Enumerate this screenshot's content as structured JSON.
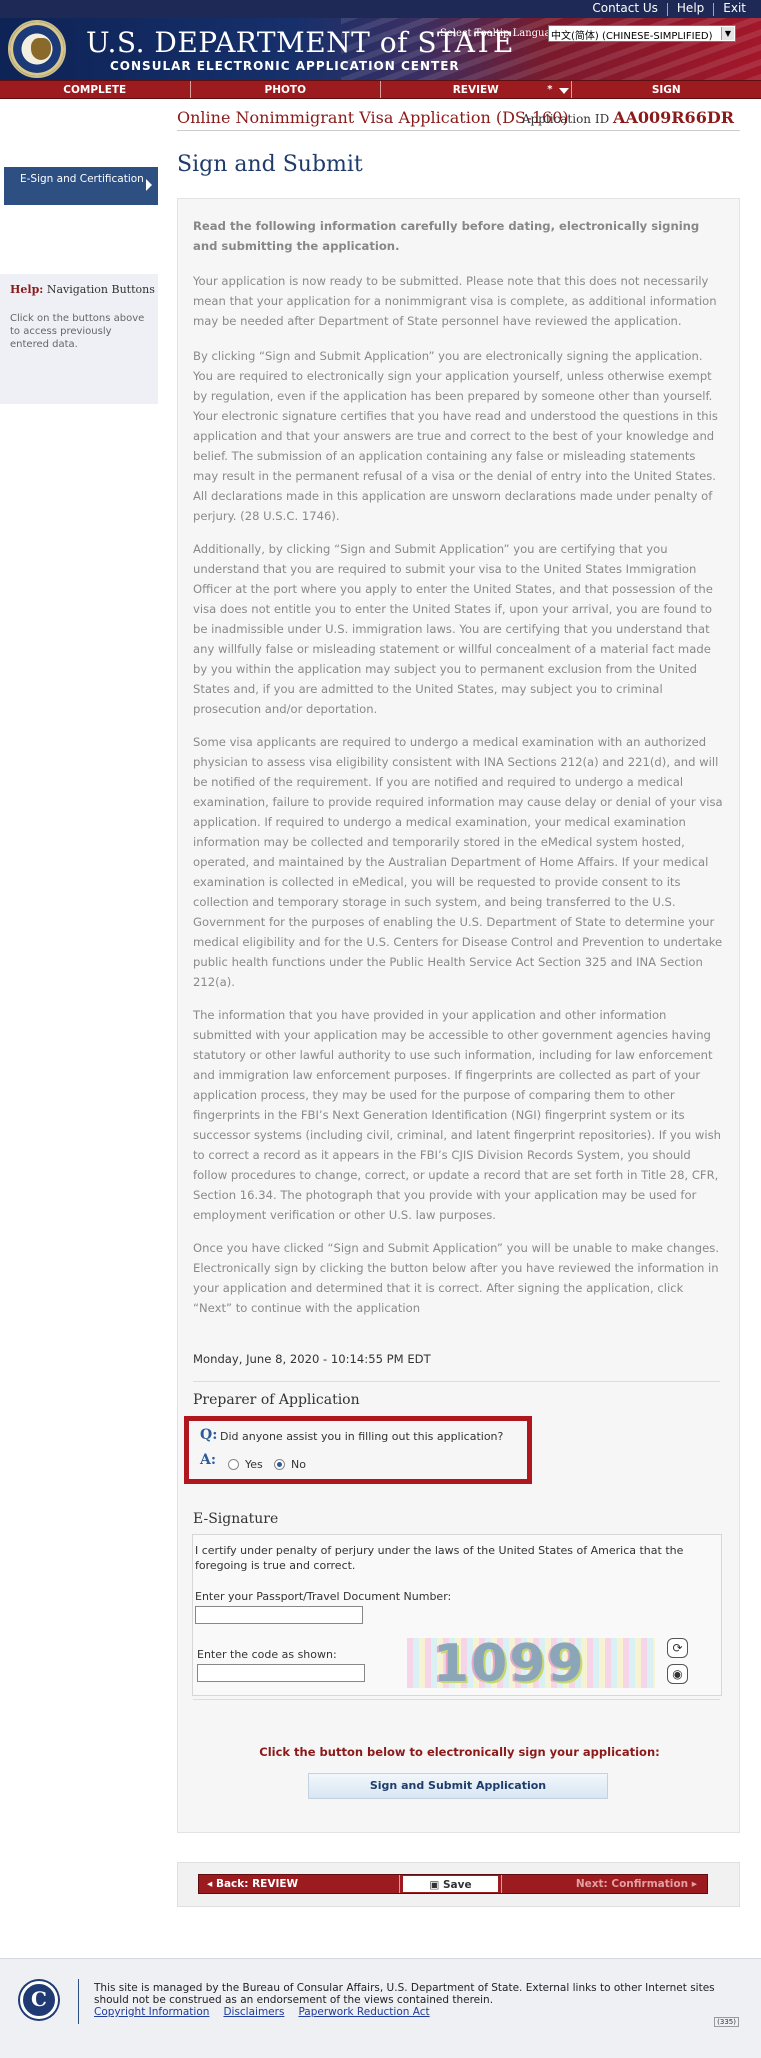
{
  "top_links": [
    "Contact Us",
    "Help",
    "Exit"
  ],
  "header": {
    "dept_name": "U.S. DEPARTMENT of STATE",
    "subtitle": "CONSULAR ELECTRONIC APPLICATION CENTER",
    "tooltip_label": "Select Tooltip Language",
    "language_selected": "中文(简体) (CHINESE-SIMPLIFIED)"
  },
  "steps": [
    "COMPLETE",
    "PHOTO",
    "REVIEW",
    "SIGN"
  ],
  "steps_review_marker": "*",
  "sidebar": {
    "active_item": "E-Sign and Certification",
    "help_title_prefix": "Help:",
    "help_title": "Navigation Buttons",
    "help_text": "Click on the buttons above to access previously entered data."
  },
  "app": {
    "form_title": "Online Nonimmigrant Visa Application (DS-160)",
    "app_id_label": "Application ID",
    "app_id": "AA009R66DR",
    "page_title": "Sign and Submit"
  },
  "content": {
    "lead": "Read the following information carefully before dating, electronically signing and submitting the application.",
    "p1": "Your application is now ready to be submitted. Please note that this does not necessarily mean that your application for a nonimmigrant visa is complete, as additional information may be needed after Department of State personnel have reviewed the application.",
    "p2": "By clicking “Sign and Submit Application” you are electronically signing the application. You are required to electronically sign your application yourself, unless otherwise exempt by regulation, even if the application has been prepared by someone other than yourself. Your electronic signature certifies that you have read and understood the questions in this application and that your answers are true and correct to the best of your knowledge and belief. The submission of an application containing any false or misleading statements may result in the permanent refusal of a visa or the denial of entry into the United States. All declarations made in this application are unsworn declarations made under penalty of perjury. (28 U.S.C. 1746).",
    "p3": "Additionally, by clicking “Sign and Submit Application” you are certifying that you understand that you are required to submit your visa to the United States Immigration Officer at the port where you apply to enter the United States, and that possession of the visa does not entitle you to enter the United States if, upon your arrival, you are found to be inadmissible under U.S. immigration laws. You are certifying that you understand that any willfully false or misleading statement or willful concealment of a material fact made by you within the application may subject you to permanent exclusion from the United States and, if you are admitted to the United States, may subject you to criminal prosecution and/or deportation.",
    "p4": "Some visa applicants are required to undergo a medical examination with an authorized physician to assess visa eligibility consistent with INA Sections 212(a) and 221(d), and will be notified of the requirement. If you are notified and required to undergo a medical examination, failure to provide required information may cause delay or denial of your visa application. If required to undergo a medical examination, your medical examination information may be collected and temporarily stored in the eMedical system hosted, operated, and maintained by the Australian Department of Home Affairs. If your medical examination is collected in eMedical, you will be requested to provide consent to its collection and temporary storage in such system, and being transferred to the U.S. Government for the purposes of enabling the U.S. Department of State to determine your medical eligibility and for the U.S. Centers for Disease Control and Prevention to undertake public health functions under the Public Health Service Act Section 325 and INA Section 212(a).",
    "p5": "The information that you have provided in your application and other information submitted with your application may be accessible to other government agencies having statutory or other lawful authority to use such information, including for law enforcement and immigration law enforcement purposes. If fingerprints are collected as part of your application process, they may be used for the purpose of comparing them to other fingerprints in the FBI’s Next Generation Identification (NGI) fingerprint system or its successor systems (including civil, criminal, and latent fingerprint repositories). If you wish to correct a record as it appears in the FBI’s CJIS Division Records System, you should follow procedures to change, correct, or update a record that are set forth in Title 28, CFR, Section 16.34. The photograph that you provide with your application may be used for employment verification or other U.S. law purposes.",
    "p6": "Once you have clicked “Sign and Submit Application” you will be unable to make changes. Electronically sign by clicking the button below after you have reviewed the information in your application and determined that it is correct. After signing the application, click “Next” to continue with the application",
    "date": "Monday, June 8, 2020 - 10:14:55 PM EDT"
  },
  "preparer": {
    "title": "Preparer of Application",
    "q_label": "Q:",
    "question": "Did anyone assist you in filling out this application?",
    "a_label": "A:",
    "yes": "Yes",
    "no": "No",
    "selected": "No"
  },
  "esignature": {
    "title": "E-Signature",
    "certify": "I certify under penalty of perjury under the laws of the United States of America that the foregoing is true and correct.",
    "passport_label": "Enter your Passport/Travel Document Number:",
    "passport_value": "",
    "code_label": "Enter the code as shown:",
    "code_value": "",
    "captcha_text": "1099"
  },
  "sign": {
    "note": "Click the button below to electronically sign your application:",
    "button": "Sign and Submit Application"
  },
  "bottom_nav": {
    "back": "Back: REVIEW",
    "save": "Save",
    "next": "Next: Confirmation"
  },
  "footer": {
    "text": "This site is managed by the Bureau of Consular Affairs, U.S. Department of State. External links to other Internet sites should not be construed as an endorsement of the views contained therein.",
    "links": [
      "Copyright Information",
      "Disclaimers",
      "Paperwork Reduction Act"
    ],
    "badge": "(335)"
  }
}
